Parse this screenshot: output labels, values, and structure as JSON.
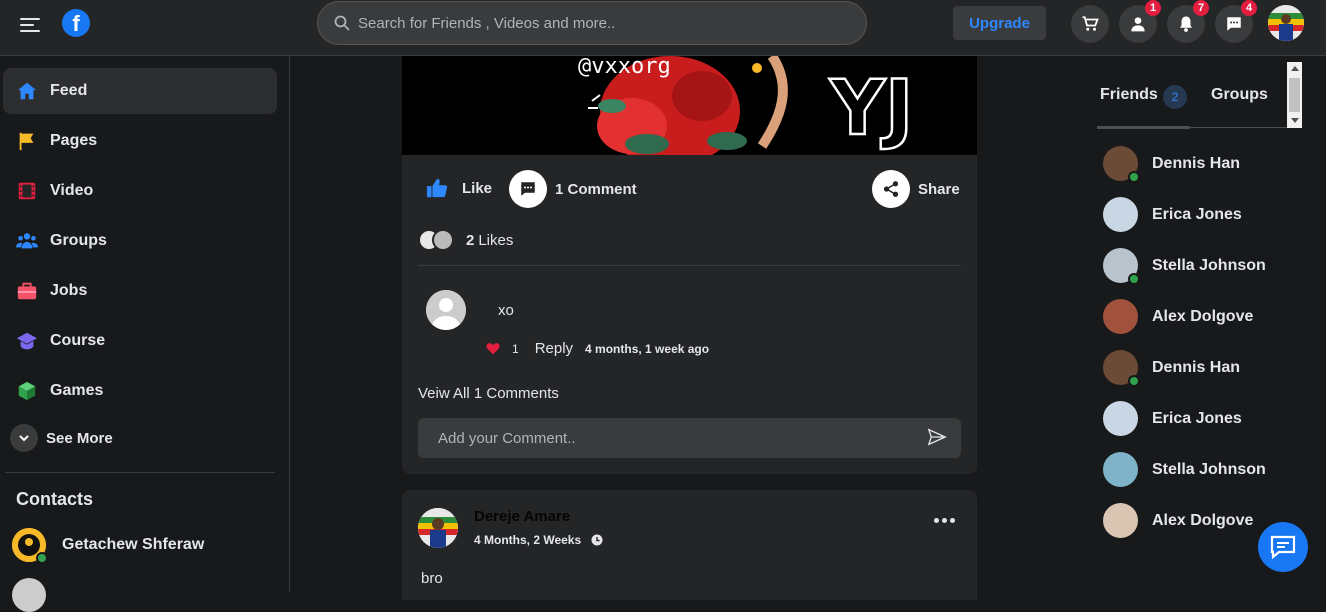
{
  "topbar": {
    "search_placeholder": "Search for Friends , Videos and more..",
    "upgrade_label": "Upgrade",
    "badges": {
      "friends": "1",
      "notifications": "7",
      "messages": "4"
    }
  },
  "nav": {
    "items": [
      {
        "label": "Feed",
        "icon": "home-icon",
        "color": "#2d88ff"
      },
      {
        "label": "Pages",
        "icon": "flag-icon",
        "color": "#f7b928"
      },
      {
        "label": "Video",
        "icon": "film-icon",
        "color": "#e41e3f"
      },
      {
        "label": "Groups",
        "icon": "users-icon",
        "color": "#2d88ff"
      },
      {
        "label": "Jobs",
        "icon": "briefcase-icon",
        "color": "#f35369"
      },
      {
        "label": "Course",
        "icon": "graduation-cap-icon",
        "color": "#7b68ee"
      },
      {
        "label": "Games",
        "icon": "cube-icon",
        "color": "#31a24c"
      }
    ],
    "see_more": "See More"
  },
  "contacts": {
    "title": "Contacts",
    "items": [
      {
        "name": "Getachew Shferaw"
      }
    ]
  },
  "post1": {
    "image_text": {
      "handle": "@vxxorg",
      "letters": "YJ"
    },
    "like_label": "Like",
    "comment_label": "1 Comment",
    "share_label": "Share",
    "likes_count": "2",
    "likes_label": "Likes",
    "comment": {
      "text": "xo",
      "like_count": "1",
      "reply_label": "Reply",
      "time": "4 months, 1 week ago"
    },
    "view_all": "Veiw All 1 Comments",
    "comment_placeholder": "Add your Comment.."
  },
  "post2": {
    "author": "Dereje Amare",
    "time": "4 Months, 2 Weeks",
    "text": "bro"
  },
  "right": {
    "tabs": {
      "friends": "Friends",
      "friends_count": "2",
      "groups": "Groups"
    },
    "friends": [
      {
        "name": "Dennis Han",
        "online": true
      },
      {
        "name": "Erica Jones",
        "online": false
      },
      {
        "name": "Stella Johnson",
        "online": true
      },
      {
        "name": "Alex Dolgove",
        "online": false
      },
      {
        "name": "Dennis Han",
        "online": true
      },
      {
        "name": "Erica Jones",
        "online": false
      },
      {
        "name": "Stella Johnson",
        "online": false
      },
      {
        "name": "Alex Dolgove",
        "online": false
      }
    ]
  },
  "colors": {
    "accent": "#1877f2",
    "bg": "#18191a",
    "card": "#242526",
    "badge": "#e41e3f",
    "online": "#31a24c"
  }
}
